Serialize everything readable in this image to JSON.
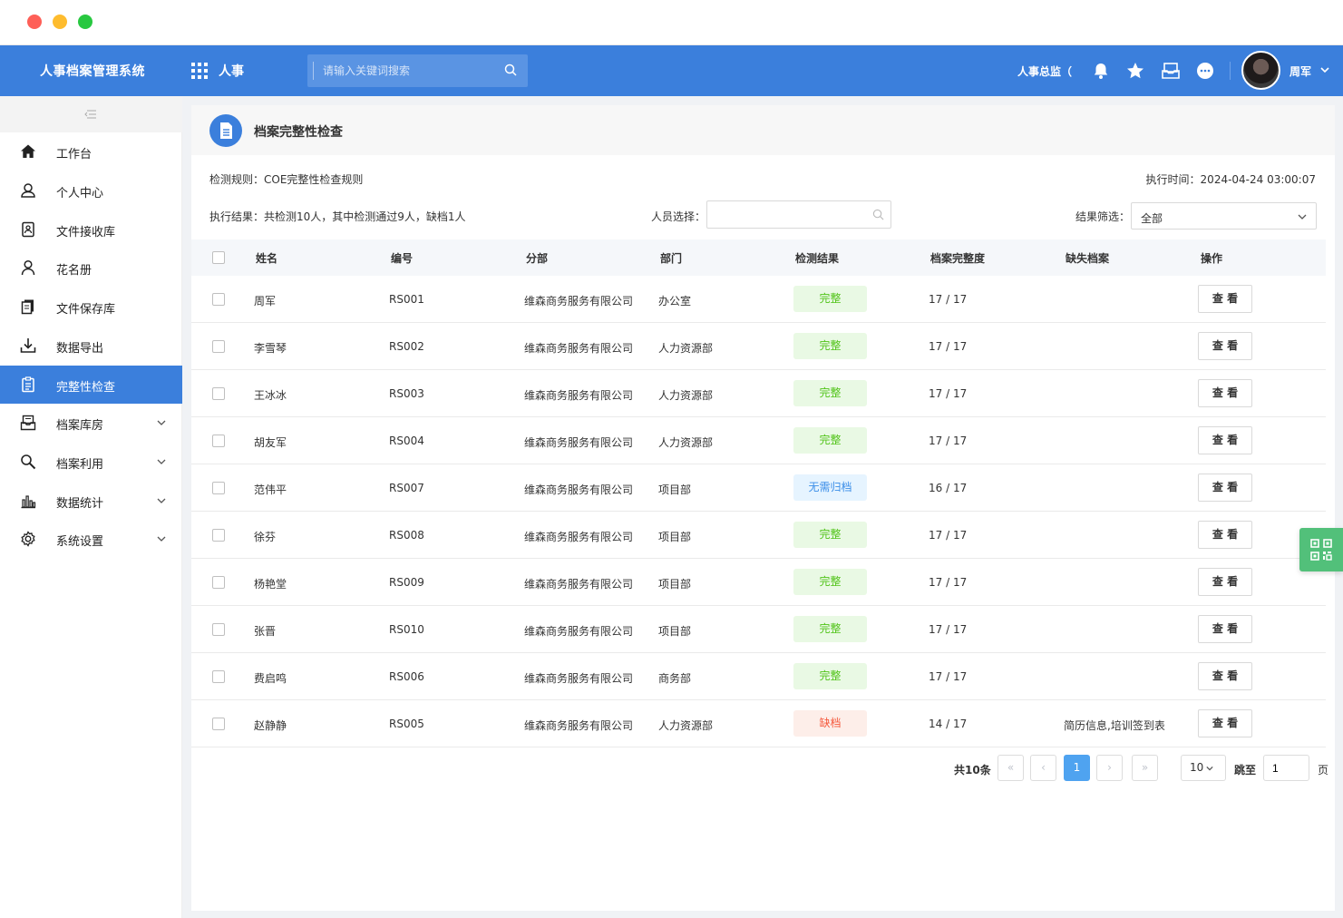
{
  "header": {
    "app_title": "人事档案管理系统",
    "module_label": "人事",
    "search_placeholder": "请输入关键词搜索",
    "role_text": "人事总监（",
    "user_name": "周军",
    "brand_color": "#3b7fdc"
  },
  "sidebar": {
    "items": [
      {
        "label": "工作台",
        "icon": "home-icon"
      },
      {
        "label": "个人中心",
        "icon": "user-icon"
      },
      {
        "label": "文件接收库",
        "icon": "file-inbox-icon"
      },
      {
        "label": "花名册",
        "icon": "person-icon"
      },
      {
        "label": "文件保存库",
        "icon": "file-store-icon"
      },
      {
        "label": "数据导出",
        "icon": "download-icon"
      },
      {
        "label": "完整性检查",
        "icon": "checklist-icon",
        "active": true
      },
      {
        "label": "档案库房",
        "icon": "archive-icon",
        "expandable": true
      },
      {
        "label": "档案利用",
        "icon": "search-icon",
        "expandable": true
      },
      {
        "label": "数据统计",
        "icon": "bar-chart-icon",
        "expandable": true
      },
      {
        "label": "系统设置",
        "icon": "gear-icon",
        "expandable": true
      }
    ]
  },
  "page": {
    "title": "档案完整性检查",
    "rule_text": "检测规则：COE完整性检查规则",
    "exec_time": "执行时间：2024-04-24 03:00:07",
    "exec_result": "执行结果：共检测10人，其中检测通过9人，缺档1人",
    "person_label": "人员选择：",
    "person_value": "",
    "filter_label": "结果筛选：",
    "filter_value": "全部"
  },
  "table": {
    "columns": [
      "姓名",
      "编号",
      "分部",
      "部门",
      "检测结果",
      "档案完整度",
      "缺失档案",
      "操作"
    ],
    "action_label": "查 看",
    "rows": [
      {
        "name": "周军",
        "id": "RS001",
        "branch": "维森商务服务有限公司",
        "dept": "办公室",
        "result": "完整",
        "status": "ok",
        "completeness": "17 / 17",
        "missing": ""
      },
      {
        "name": "李雪琴",
        "id": "RS002",
        "branch": "维森商务服务有限公司",
        "dept": "人力资源部",
        "result": "完整",
        "status": "ok",
        "completeness": "17 / 17",
        "missing": ""
      },
      {
        "name": "王冰冰",
        "id": "RS003",
        "branch": "维森商务服务有限公司",
        "dept": "人力资源部",
        "result": "完整",
        "status": "ok",
        "completeness": "17 / 17",
        "missing": ""
      },
      {
        "name": "胡友军",
        "id": "RS004",
        "branch": "维森商务服务有限公司",
        "dept": "人力资源部",
        "result": "完整",
        "status": "ok",
        "completeness": "17 / 17",
        "missing": ""
      },
      {
        "name": "范伟平",
        "id": "RS007",
        "branch": "维森商务服务有限公司",
        "dept": "项目部",
        "result": "无需归档",
        "status": "na",
        "completeness": "16 / 17",
        "missing": ""
      },
      {
        "name": "徐芬",
        "id": "RS008",
        "branch": "维森商务服务有限公司",
        "dept": "项目部",
        "result": "完整",
        "status": "ok",
        "completeness": "17 / 17",
        "missing": ""
      },
      {
        "name": "杨艳堂",
        "id": "RS009",
        "branch": "维森商务服务有限公司",
        "dept": "项目部",
        "result": "完整",
        "status": "ok",
        "completeness": "17 / 17",
        "missing": ""
      },
      {
        "name": "张晋",
        "id": "RS010",
        "branch": "维森商务服务有限公司",
        "dept": "项目部",
        "result": "完整",
        "status": "ok",
        "completeness": "17 / 17",
        "missing": ""
      },
      {
        "name": "费启鸣",
        "id": "RS006",
        "branch": "维森商务服务有限公司",
        "dept": "商务部",
        "result": "完整",
        "status": "ok",
        "completeness": "17 / 17",
        "missing": ""
      },
      {
        "name": "赵静静",
        "id": "RS005",
        "branch": "维森商务服务有限公司",
        "dept": "人力资源部",
        "result": "缺档",
        "status": "miss",
        "completeness": "14 / 17",
        "missing": "简历信息,培训签到表"
      }
    ]
  },
  "pagination": {
    "total": "共10条",
    "first": "«",
    "prev": "‹",
    "current": "1",
    "next": "›",
    "last": "»",
    "page_size": "10",
    "jump_label": "跳至",
    "jump_value": "1",
    "page_unit": "页"
  }
}
